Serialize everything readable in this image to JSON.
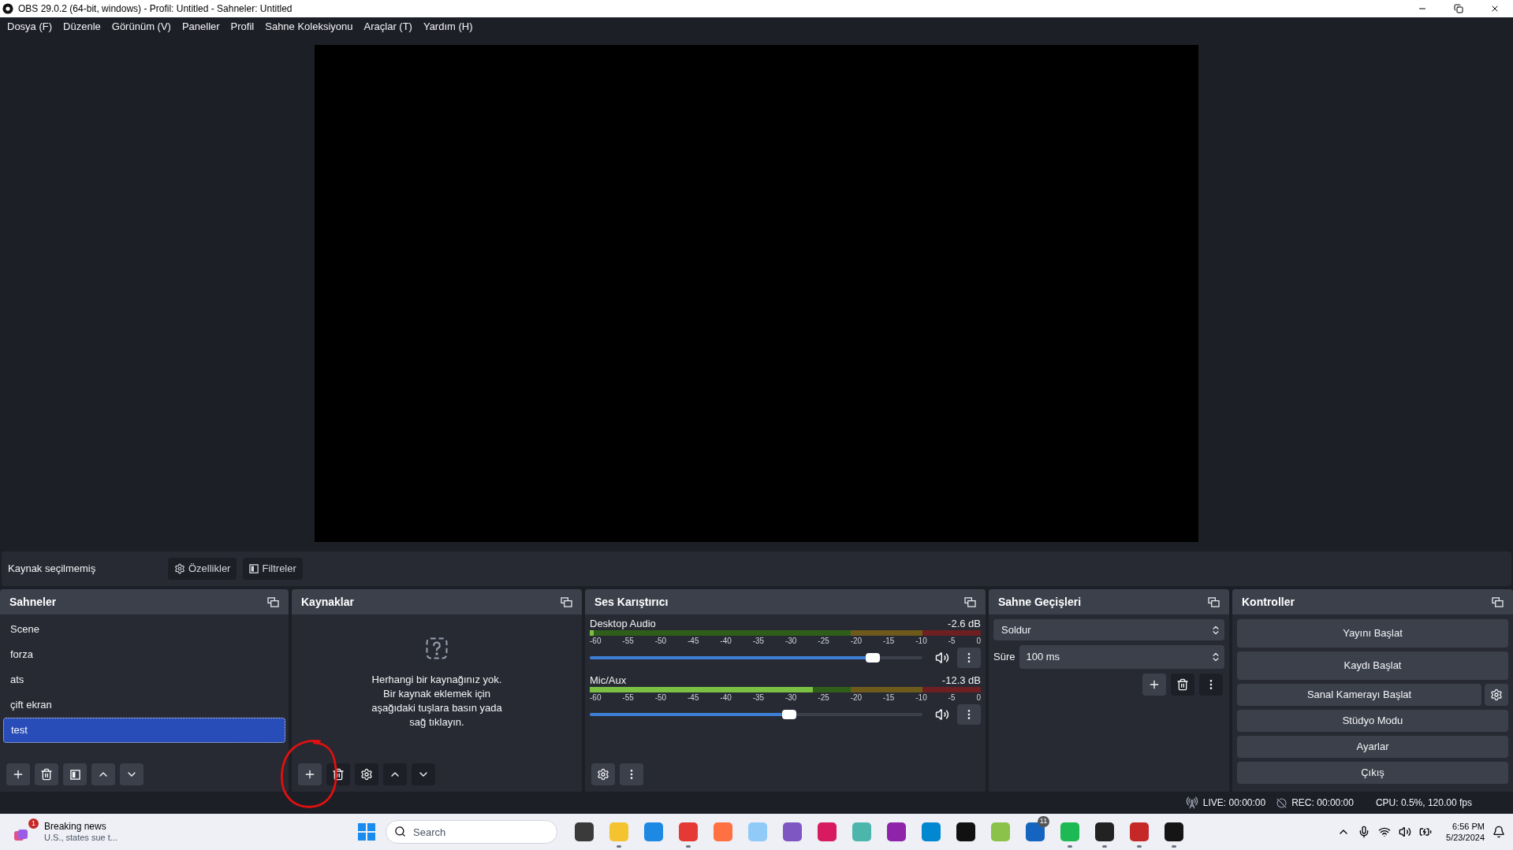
{
  "window": {
    "title": "OBS 29.0.2 (64-bit, windows) - Profil: Untitled - Sahneler: Untitled"
  },
  "menu": [
    "Dosya (F)",
    "Düzenle",
    "Görünüm (V)",
    "Paneller",
    "Profil",
    "Sahne Koleksiyonu",
    "Araçlar (T)",
    "Yardım (H)"
  ],
  "source_toolbar": {
    "label": "Kaynak seçilmemiş",
    "buttons": [
      {
        "kind": "properties",
        "label": "Özellikler"
      },
      {
        "kind": "filters",
        "label": "Filtreler"
      }
    ]
  },
  "scenes": {
    "title": "Sahneler",
    "items": [
      {
        "label": "Scene",
        "selected": false
      },
      {
        "label": "forza",
        "selected": false
      },
      {
        "label": "ats",
        "selected": false
      },
      {
        "label": "çift ekran",
        "selected": false
      },
      {
        "label": "test",
        "selected": true
      }
    ],
    "toolbar": [
      {
        "kind": "add",
        "disabled": false
      },
      {
        "kind": "remove",
        "disabled": false
      },
      {
        "kind": "filters",
        "disabled": false
      },
      {
        "kind": "up",
        "disabled": false
      },
      {
        "kind": "down",
        "disabled": false
      }
    ]
  },
  "sources": {
    "title": "Kaynaklar",
    "empty_message": "Herhangi bir kaynağınız yok.\nBir kaynak eklemek için\naşağıdaki tuşlara basın yada\nsağ tıklayın.",
    "toolbar": [
      {
        "kind": "add",
        "disabled": false
      },
      {
        "kind": "remove",
        "disabled": true
      },
      {
        "kind": "properties",
        "disabled": true
      },
      {
        "kind": "up",
        "disabled": true
      },
      {
        "kind": "down",
        "disabled": true
      }
    ]
  },
  "mixer": {
    "title": "Ses Karıştırıcı",
    "channels": [
      {
        "name": "Desktop Audio",
        "reading": "-2.6 dB",
        "meter": {
          "level": 0.01
        },
        "fader": {
          "level": 0.85
        },
        "ticks": [
          "-60",
          "-55",
          "-50",
          "-45",
          "-40",
          "-35",
          "-30",
          "-25",
          "-20",
          "-15",
          "-10",
          "-5",
          "0"
        ]
      },
      {
        "name": "Mic/Aux",
        "reading": "-12.3 dB",
        "meter": {
          "level": 0.57
        },
        "fader": {
          "level": 0.6
        },
        "ticks": [
          "-60",
          "-55",
          "-50",
          "-45",
          "-40",
          "-35",
          "-30",
          "-25",
          "-20",
          "-15",
          "-10",
          "-5",
          "0"
        ]
      }
    ],
    "toolbar": [
      {
        "kind": "properties",
        "disabled": false
      },
      {
        "kind": "menu",
        "disabled": false
      }
    ]
  },
  "transitions": {
    "title": "Sahne Geçişleri",
    "transition": "Soldur",
    "duration_label": "Süre",
    "duration": "100 ms",
    "toolbar": [
      {
        "kind": "add",
        "disabled": false
      },
      {
        "kind": "remove",
        "disabled": true
      },
      {
        "kind": "menu",
        "disabled": true
      }
    ]
  },
  "controls": {
    "title": "Kontroller",
    "buttons": [
      {
        "label": "Yayını Başlat",
        "settings_button": false
      },
      {
        "label": "Kaydı Başlat",
        "settings_button": false
      },
      {
        "label": "Sanal Kamerayı Başlat",
        "settings_button": true
      },
      {
        "label": "Stüdyo Modu",
        "settings_button": false
      },
      {
        "label": "Ayarlar",
        "settings_button": false
      },
      {
        "label": "Çıkış",
        "settings_button": false
      }
    ]
  },
  "status_bar": {
    "live": "LIVE: 00:00:00",
    "rec": "REC: 00:00:00",
    "cpu": "CPU: 0.5%, 120.00 fps"
  },
  "taskbar": {
    "news": {
      "title": "Breaking news",
      "subtitle": "U.S., states sue t...",
      "badge": "1"
    },
    "search": {
      "placeholder": "Search"
    },
    "apps": [
      {
        "color": "#3a3a3a",
        "running": false
      },
      {
        "color": "#f4c430",
        "running": true
      },
      {
        "color": "#1e88e5",
        "running": false
      },
      {
        "color": "#e53935",
        "running": true
      },
      {
        "color": "#ff7043",
        "running": false
      },
      {
        "color": "#90caf9",
        "running": false
      },
      {
        "color": "#7e57c2",
        "running": false
      },
      {
        "color": "#d81b60",
        "running": false
      },
      {
        "color": "#4db6ac",
        "running": false
      },
      {
        "color": "#8e24aa",
        "running": false
      },
      {
        "color": "#0288d1",
        "running": false
      },
      {
        "color": "#111111",
        "running": false
      },
      {
        "color": "#8bc34a",
        "running": false
      },
      {
        "color": "#1565c0",
        "running": false,
        "badge": "11"
      },
      {
        "color": "#1db954",
        "running": true
      },
      {
        "color": "#222222",
        "running": true
      },
      {
        "color": "#c62828",
        "running": true
      },
      {
        "color": "#151515",
        "running": true
      }
    ],
    "time": "6:56 PM",
    "date": "5/23/2024"
  }
}
